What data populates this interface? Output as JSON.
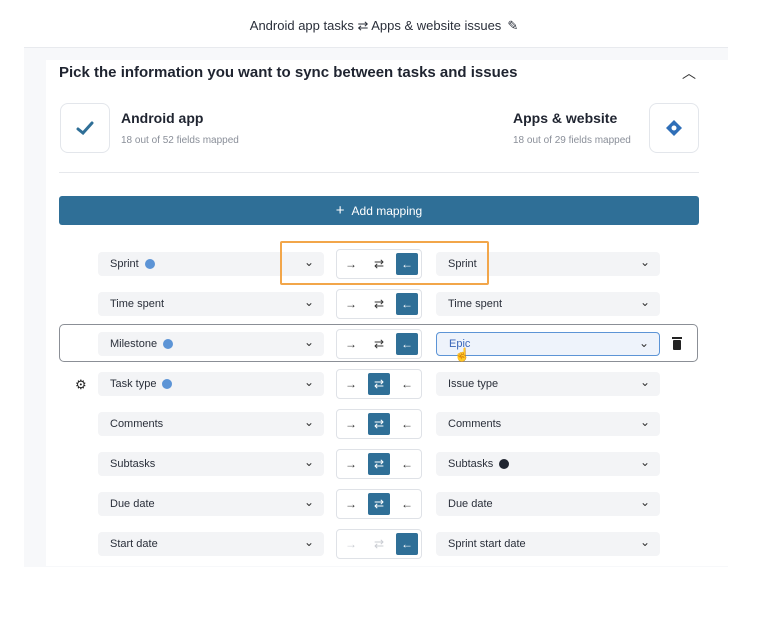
{
  "header": {
    "title": "Android app tasks ⇄ Apps & website issues"
  },
  "section": {
    "title": "Pick the information you want to sync between tasks and issues"
  },
  "left_app": {
    "name": "Android app",
    "mapped": "18 out of 52 fields mapped"
  },
  "right_app": {
    "name": "Apps & website",
    "mapped": "18 out of 29 fields mapped"
  },
  "add_mapping": {
    "label": "Add mapping"
  },
  "mappings": [
    {
      "left": "Sprint",
      "right": "Sprint",
      "direction": "right-to-left"
    },
    {
      "left": "Time spent",
      "right": "Time spent",
      "direction": "right-to-left"
    },
    {
      "left": "Milestone",
      "right": "Epic",
      "direction": "right-to-left"
    },
    {
      "left": "Task type",
      "right": "Issue type",
      "direction": "both"
    },
    {
      "left": "Comments",
      "right": "Comments",
      "direction": "both"
    },
    {
      "left": "Subtasks",
      "right": "Subtasks",
      "direction": "both"
    },
    {
      "left": "Due date",
      "right": "Due date",
      "direction": "both"
    },
    {
      "left": "Start date",
      "right": "Sprint start date",
      "direction": "right-to-left"
    }
  ],
  "colors": {
    "accent": "#2f6f97",
    "highlight": "#f2a64a",
    "info": "#5c94d6"
  },
  "icons": [
    "pencil-icon",
    "chevron-up-icon",
    "checkmark-logo-icon",
    "diamond-logo-icon",
    "plus-icon",
    "chevron-down-icon",
    "info-icon",
    "arrow-right-icon",
    "two-way-arrow-icon",
    "arrow-left-icon",
    "gear-icon",
    "trash-icon",
    "cursor-icon"
  ]
}
